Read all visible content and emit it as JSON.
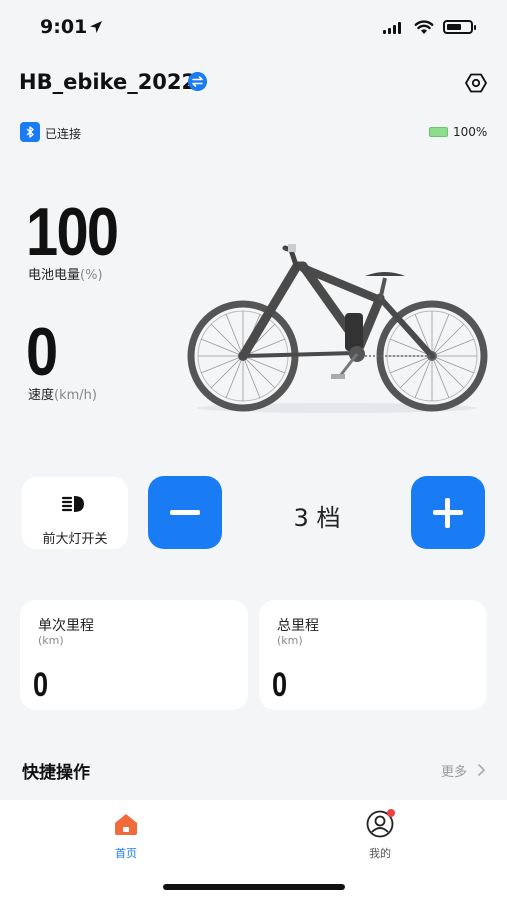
{
  "status_bar": {
    "time": "9:01"
  },
  "header": {
    "device_name": "HB_ebike_2022",
    "switch_icon": "switch-icon",
    "settings_icon": "settings-icon"
  },
  "connection": {
    "status": "已连接",
    "battery_percent_text": "100%",
    "icon": "bluetooth-icon"
  },
  "metrics": {
    "battery": {
      "value": "100",
      "label": "电池电量",
      "unit": "(%)"
    },
    "speed": {
      "value": "0",
      "label": "速度",
      "unit": "(km/h)"
    }
  },
  "controls": {
    "headlight_label": "前大灯开关",
    "gear_label": "3 档",
    "gear_level": 3
  },
  "mileage": {
    "trip": {
      "title": "单次里程",
      "unit": "(km)",
      "value": "0"
    },
    "total": {
      "title": "总里程",
      "unit": "(km)",
      "value": "0"
    }
  },
  "quick_actions": {
    "title": "快捷操作",
    "more_label": "更多"
  },
  "tabbar": {
    "home_label": "首页",
    "me_label": "我的"
  },
  "colors": {
    "accent": "#1a7cf5",
    "background": "#f4f5f7",
    "notification": "#f04040",
    "battery_green": "#8fdc8f"
  }
}
